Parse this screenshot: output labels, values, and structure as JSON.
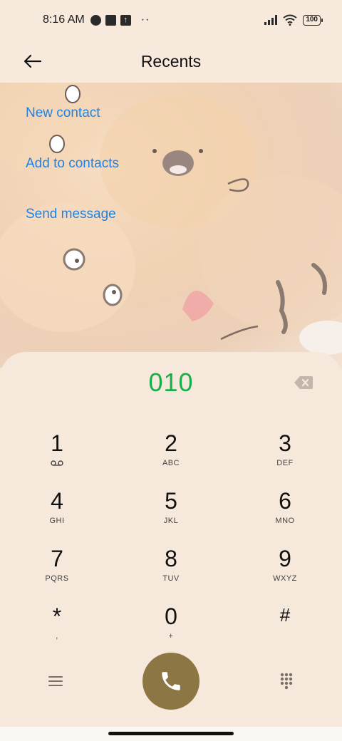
{
  "status_bar": {
    "time": "8:16 AM",
    "dots": "··",
    "battery": "100",
    "upload_glyph": "↑",
    "icons": [
      "notification-circle-icon",
      "square-app-icon",
      "upload-icon",
      "signal-icon",
      "wifi-icon",
      "battery-icon"
    ]
  },
  "header": {
    "title": "Recents",
    "back_icon": "arrow-left-icon"
  },
  "actions": {
    "new_contact": "New contact",
    "add_to_contacts": "Add to contacts",
    "send_message": "Send message"
  },
  "dialer": {
    "number": "010",
    "backspace_icon": "backspace-icon",
    "keys": [
      {
        "digit": "1",
        "letters": "",
        "sub_icon": "voicemail-icon"
      },
      {
        "digit": "2",
        "letters": "ABC"
      },
      {
        "digit": "3",
        "letters": "DEF"
      },
      {
        "digit": "4",
        "letters": "GHI"
      },
      {
        "digit": "5",
        "letters": "JKL"
      },
      {
        "digit": "6",
        "letters": "MNO"
      },
      {
        "digit": "7",
        "letters": "PQRS"
      },
      {
        "digit": "8",
        "letters": "TUV"
      },
      {
        "digit": "9",
        "letters": "WXYZ"
      },
      {
        "digit": "*",
        "letters": ","
      },
      {
        "digit": "0",
        "letters": "+"
      },
      {
        "digit": "#",
        "letters": ""
      }
    ],
    "bottom": {
      "menu_icon": "menu-icon",
      "call_icon": "phone-icon",
      "keypad_icon": "dialpad-icon"
    }
  },
  "colors": {
    "accent_link": "#1f82e6",
    "number_green": "#15b04a",
    "call_button": "#8c7643",
    "background": "#f6e8da"
  }
}
